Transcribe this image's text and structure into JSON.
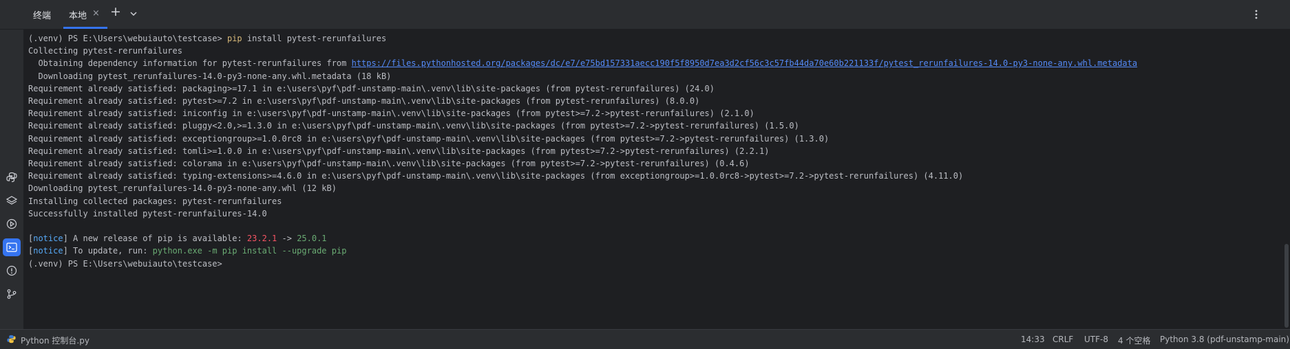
{
  "tabbar": {
    "title": "终端",
    "tabs": [
      {
        "label": "本地",
        "active": true
      }
    ],
    "close_glyph": "×",
    "add_glyph": "+",
    "icons": [
      "chevron-down-icon",
      "more-vertical-icon"
    ]
  },
  "sidebar": {
    "items": [
      {
        "name": "python-console-icon"
      },
      {
        "name": "layers-icon"
      },
      {
        "name": "services-run-icon"
      },
      {
        "name": "terminal-icon",
        "active": true
      },
      {
        "name": "problems-icon"
      },
      {
        "name": "git-icon"
      }
    ]
  },
  "terminal": {
    "lines": [
      {
        "prompt": "(.venv) PS E:\\Users\\webuiauto\\testcase> ",
        "command": "pip",
        "args": " install pytest-rerunfailures"
      },
      {
        "text": "Collecting pytest-rerunfailures"
      },
      {
        "text": "  Obtaining dependency information for pytest-rerunfailures from ",
        "link": "https://files.pythonhosted.org/packages/dc/e7/e75bd157331aecc190f5f8950d7ea3d2cf56c3c57fb44da70e60b221133f/pytest_rerunfailures-14.0-py3-none-any.whl.metadata"
      },
      {
        "text": "  Downloading pytest_rerunfailures-14.0-py3-none-any.whl.metadata (18 kB)"
      },
      {
        "text": "Requirement already satisfied: packaging>=17.1 in e:\\users\\pyf\\pdf-unstamp-main\\.venv\\lib\\site-packages (from pytest-rerunfailures) (24.0)"
      },
      {
        "text": "Requirement already satisfied: pytest>=7.2 in e:\\users\\pyf\\pdf-unstamp-main\\.venv\\lib\\site-packages (from pytest-rerunfailures) (8.0.0)"
      },
      {
        "text": "Requirement already satisfied: iniconfig in e:\\users\\pyf\\pdf-unstamp-main\\.venv\\lib\\site-packages (from pytest>=7.2->pytest-rerunfailures) (2.1.0)"
      },
      {
        "text": "Requirement already satisfied: pluggy<2.0,>=1.3.0 in e:\\users\\pyf\\pdf-unstamp-main\\.venv\\lib\\site-packages (from pytest>=7.2->pytest-rerunfailures) (1.5.0)"
      },
      {
        "text": "Requirement already satisfied: exceptiongroup>=1.0.0rc8 in e:\\users\\pyf\\pdf-unstamp-main\\.venv\\lib\\site-packages (from pytest>=7.2->pytest-rerunfailures) (1.3.0)"
      },
      {
        "text": "Requirement already satisfied: tomli>=1.0.0 in e:\\users\\pyf\\pdf-unstamp-main\\.venv\\lib\\site-packages (from pytest>=7.2->pytest-rerunfailures) (2.2.1)"
      },
      {
        "text": "Requirement already satisfied: colorama in e:\\users\\pyf\\pdf-unstamp-main\\.venv\\lib\\site-packages (from pytest>=7.2->pytest-rerunfailures) (0.4.6)"
      },
      {
        "text": "Requirement already satisfied: typing-extensions>=4.6.0 in e:\\users\\pyf\\pdf-unstamp-main\\.venv\\lib\\site-packages (from exceptiongroup>=1.0.0rc8->pytest>=7.2->pytest-rerunfailures) (4.11.0)"
      },
      {
        "text": "Downloading pytest_rerunfailures-14.0-py3-none-any.whl (12 kB)"
      },
      {
        "text": "Installing collected packages: pytest-rerunfailures"
      },
      {
        "text": "Successfully installed pytest-rerunfailures-14.0"
      },
      {
        "text": ""
      },
      {
        "notice_open": "[",
        "notice_tag": "notice",
        "notice_close": "]",
        "msg": " A new release of pip is available: ",
        "old_version": "23.2.1",
        "arrow": " -> ",
        "new_version": "25.0.1"
      },
      {
        "notice_open": "[",
        "notice_tag": "notice",
        "notice_close": "]",
        "msg": " To update, run: ",
        "update_cmd": "python.exe -m pip install --upgrade pip"
      },
      {
        "prompt": "(.venv) PS E:\\Users\\webuiauto\\testcase>"
      }
    ]
  },
  "statusbar": {
    "console": "Python 控制台.py",
    "time": "14:33",
    "line_ending": "CRLF",
    "encoding": "UTF-8",
    "indent": "4 个空格",
    "interpreter": "Python 3.8 (pdf-unstamp-main)"
  },
  "colors": {
    "background": "#1e1f22",
    "panel": "#2b2d30",
    "accent": "#3574f0",
    "command": "#d5b778",
    "link": "#548af7",
    "notice": "#56a8f5",
    "error_red": "#f75464",
    "success_green": "#6aab73"
  }
}
